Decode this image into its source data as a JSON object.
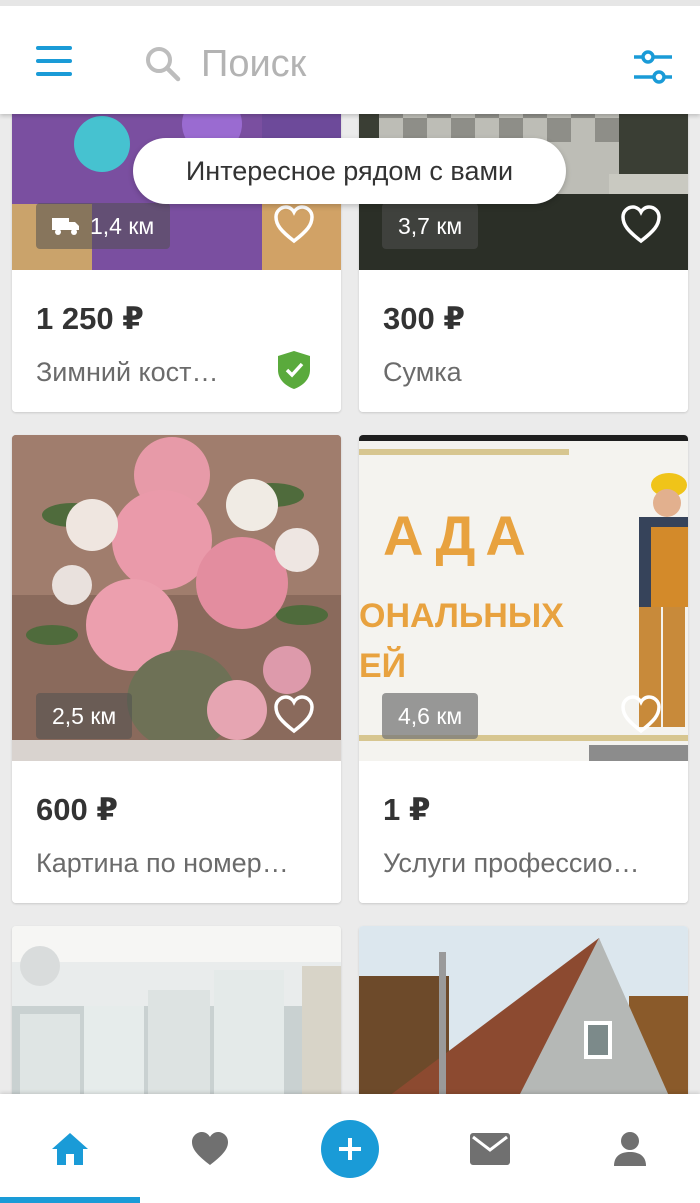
{
  "header": {
    "search_placeholder": "Поиск"
  },
  "chip": {
    "label": "Интересное рядом с вами"
  },
  "cards": [
    {
      "price": "1 250 ₽",
      "title": "Зимний кост…",
      "distance": "1,4 км",
      "has_delivery": true,
      "verified": true
    },
    {
      "price": "300 ₽",
      "title": "Сумка",
      "distance": "3,7 км"
    },
    {
      "price": "600 ₽",
      "title": "Картина по номер…",
      "distance": "2,5 км"
    },
    {
      "price": "1 ₽",
      "title": "Услуги профессио…",
      "distance": "4,6 км",
      "ad_text": [
        "АДА",
        "ОНАЛЬНЫХ",
        "ЕЙ"
      ]
    },
    {
      "price": "",
      "title": ""
    },
    {
      "price": "",
      "title": ""
    }
  ],
  "bottom_nav": [
    {
      "icon": "home-icon",
      "active": true
    },
    {
      "icon": "heart-icon"
    },
    {
      "icon": "plus-icon"
    },
    {
      "icon": "mail-icon"
    },
    {
      "icon": "person-icon"
    }
  ],
  "colors": {
    "accent": "#1a9bd7",
    "verified": "#5aaa3c"
  }
}
